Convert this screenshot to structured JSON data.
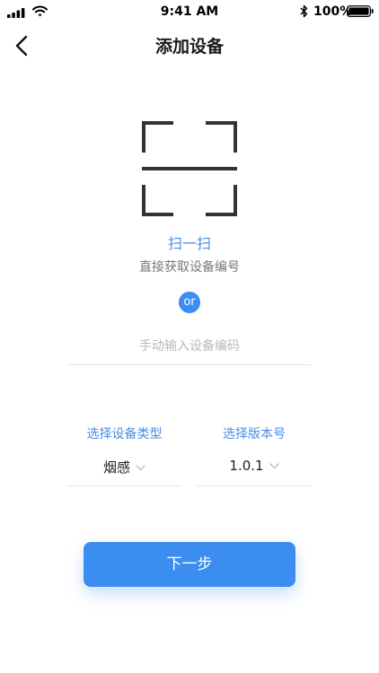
{
  "status_bar": {
    "time": "9:41 AM",
    "battery_percent": "100%",
    "icons": [
      "signal-icon",
      "wifi-icon",
      "bluetooth-icon",
      "battery-icon"
    ]
  },
  "nav": {
    "title": "添加设备",
    "back_icon": "chevron-left-icon"
  },
  "scan": {
    "icon": "scan-frame-icon",
    "title": "扫一扫",
    "subtitle": "直接获取设备编号"
  },
  "divider_or": "or",
  "manual_input": {
    "placeholder": "手动输入设备编码",
    "value": ""
  },
  "selectors": {
    "device_type": {
      "label": "选择设备类型",
      "value": "烟感",
      "icon": "chevron-down-icon"
    },
    "version": {
      "label": "选择版本号",
      "value": "1.0.1",
      "icon": "chevron-down-icon"
    }
  },
  "next_button": {
    "label": "下一步"
  },
  "colors": {
    "accent": "#3b8df0",
    "link_text": "#4a8ee3",
    "divider": "#e6e6e6",
    "placeholder": "#b9b9b9"
  }
}
